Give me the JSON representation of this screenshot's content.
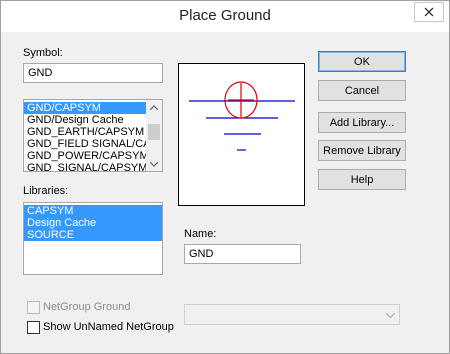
{
  "window": {
    "title": "Place Ground",
    "close_icon": "close-icon"
  },
  "symbol": {
    "label": "Symbol:",
    "value": "GND",
    "list": [
      {
        "label": "GND/CAPSYM",
        "selected": true
      },
      {
        "label": "GND/Design Cache",
        "selected": false
      },
      {
        "label": "GND_EARTH/CAPSYM",
        "selected": false
      },
      {
        "label": "GND_FIELD SIGNAL/CA",
        "selected": false
      },
      {
        "label": "GND_POWER/CAPSYM",
        "selected": false
      },
      {
        "label": "GND_SIGNAL/CAPSYM",
        "selected": false
      }
    ]
  },
  "libraries": {
    "label": "Libraries:",
    "items": [
      {
        "label": "CAPSYM",
        "selected": true
      },
      {
        "label": "Design Cache",
        "selected": true
      },
      {
        "label": "SOURCE",
        "selected": true
      }
    ]
  },
  "name": {
    "label": "Name:",
    "value": "GND"
  },
  "buttons": {
    "ok": "OK",
    "cancel": "Cancel",
    "add_library": "Add Library...",
    "remove_library": "Remove Library",
    "help": "Help"
  },
  "netgroup_ground": {
    "label": "NetGroup Ground",
    "checked": false,
    "enabled": false
  },
  "show_unnamed": {
    "label": "Show UnNamed NetGroup",
    "checked": false,
    "enabled": true
  },
  "netgroup_combo": {
    "value": "",
    "enabled": false
  },
  "colors": {
    "selection": "#3399ff",
    "ground_symbol": "#0000cc",
    "origin_marker": "#e00000"
  }
}
